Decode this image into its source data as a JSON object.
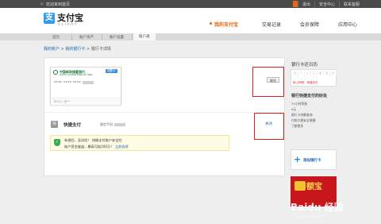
{
  "topbar": {
    "home_link": "欢迎来到首页",
    "right_items": [
      {
        "label": "",
        "highlight": true
      },
      {
        "label": "退出"
      },
      {
        "label": "安全中心"
      },
      {
        "label": "联系客服"
      }
    ]
  },
  "header": {
    "logo_mark": "支",
    "logo_text": "支付宝",
    "logo_sub": "ALIPAY",
    "nav": [
      "我的支付宝",
      "交易记录",
      "会员保障",
      "应用中心"
    ]
  },
  "subnav": [
    "首页",
    "账户资产",
    "账户设置",
    "账户通"
  ],
  "breadcrumb": {
    "home": "我的账户",
    "sep1": ">",
    "bankcards": "我的银行卡",
    "sep2": ">",
    "current": "银行卡详情"
  },
  "card": {
    "bank_name": "中国邮政储蓄银行",
    "bank_en": "POSTAL SAVINGS BANK OF CHINA",
    "badge": "储蓄卡",
    "number": "**** **** ****",
    "foot": "持卡人: 张**",
    "unbind_label": "解除"
  },
  "quick_pay": {
    "icon": "快",
    "title": "快捷支付",
    "subtitle": "绑定手机",
    "close_label": "关闭"
  },
  "notice": {
    "line1": "有保险，没风险！ 快捷支付账户安全险",
    "line2": "账户资金被盗，最高可赔100万！",
    "link": "立即投保"
  },
  "sidebar": {
    "calendar_title": "银行卡还日历",
    "calendar_days": [
      "日",
      "一",
      "二",
      "三",
      "四",
      "五",
      "六"
    ],
    "calendar_msg": "网上购物、快捷支付",
    "benefits_title": "银行快捷支付的好处",
    "benefits": [
      "72小时到账",
      "0元",
      "银行卡余额查询",
      "付款方便安全便捷",
      "了解更多"
    ],
    "add_card_label": "添加银行卡",
    "promo_text": "额宝",
    "watermark": "Baidu 经验",
    "watermark_sub": "jingyan.baidu.com"
  },
  "colors": {
    "accent": "#e8650e",
    "link": "#1a66b3",
    "brand_blue": "#2f9cec",
    "highlight_box": "#e02020"
  }
}
